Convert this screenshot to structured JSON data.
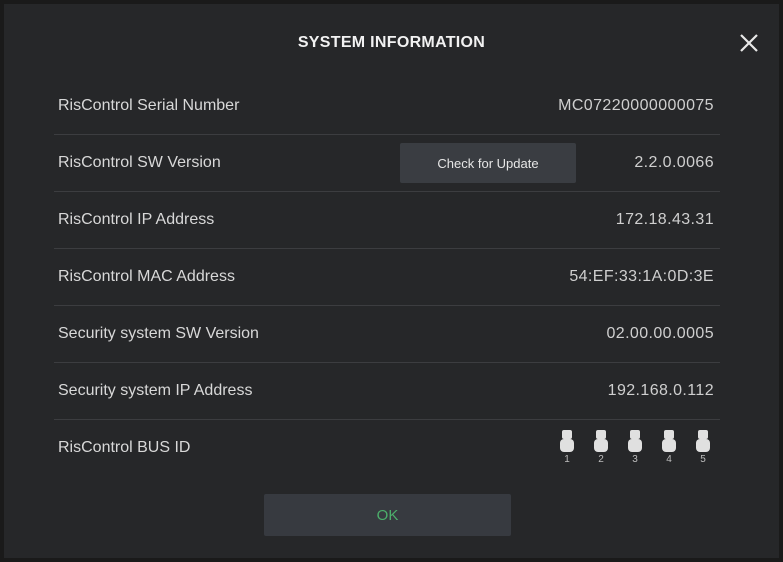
{
  "dialog": {
    "title": "SYSTEM INFORMATION",
    "close_icon": "close-icon"
  },
  "rows": [
    {
      "label": "RisControl Serial Number",
      "value": "MC07220000000075"
    },
    {
      "label": "RisControl SW Version",
      "value": "2.2.0.0066",
      "button": "Check for Update"
    },
    {
      "label": "RisControl IP Address",
      "value": "172.18.43.31"
    },
    {
      "label": "RisControl MAC Address",
      "value": "54:EF:33:1A:0D:3E"
    },
    {
      "label": "Security system SW Version",
      "value": "02.00.00.0005"
    },
    {
      "label": "Security system IP Address",
      "value": "192.168.0.112"
    },
    {
      "label": "RisControl BUS ID"
    }
  ],
  "bus_id_switches": [
    {
      "number": "1",
      "position": "up"
    },
    {
      "number": "2",
      "position": "up"
    },
    {
      "number": "3",
      "position": "up"
    },
    {
      "number": "4",
      "position": "up"
    },
    {
      "number": "5",
      "position": "up"
    }
  ],
  "footer": {
    "ok_label": "OK"
  },
  "colors": {
    "background": "#262729",
    "ok_text": "#4caf6b",
    "divider": "#3c3d40"
  }
}
